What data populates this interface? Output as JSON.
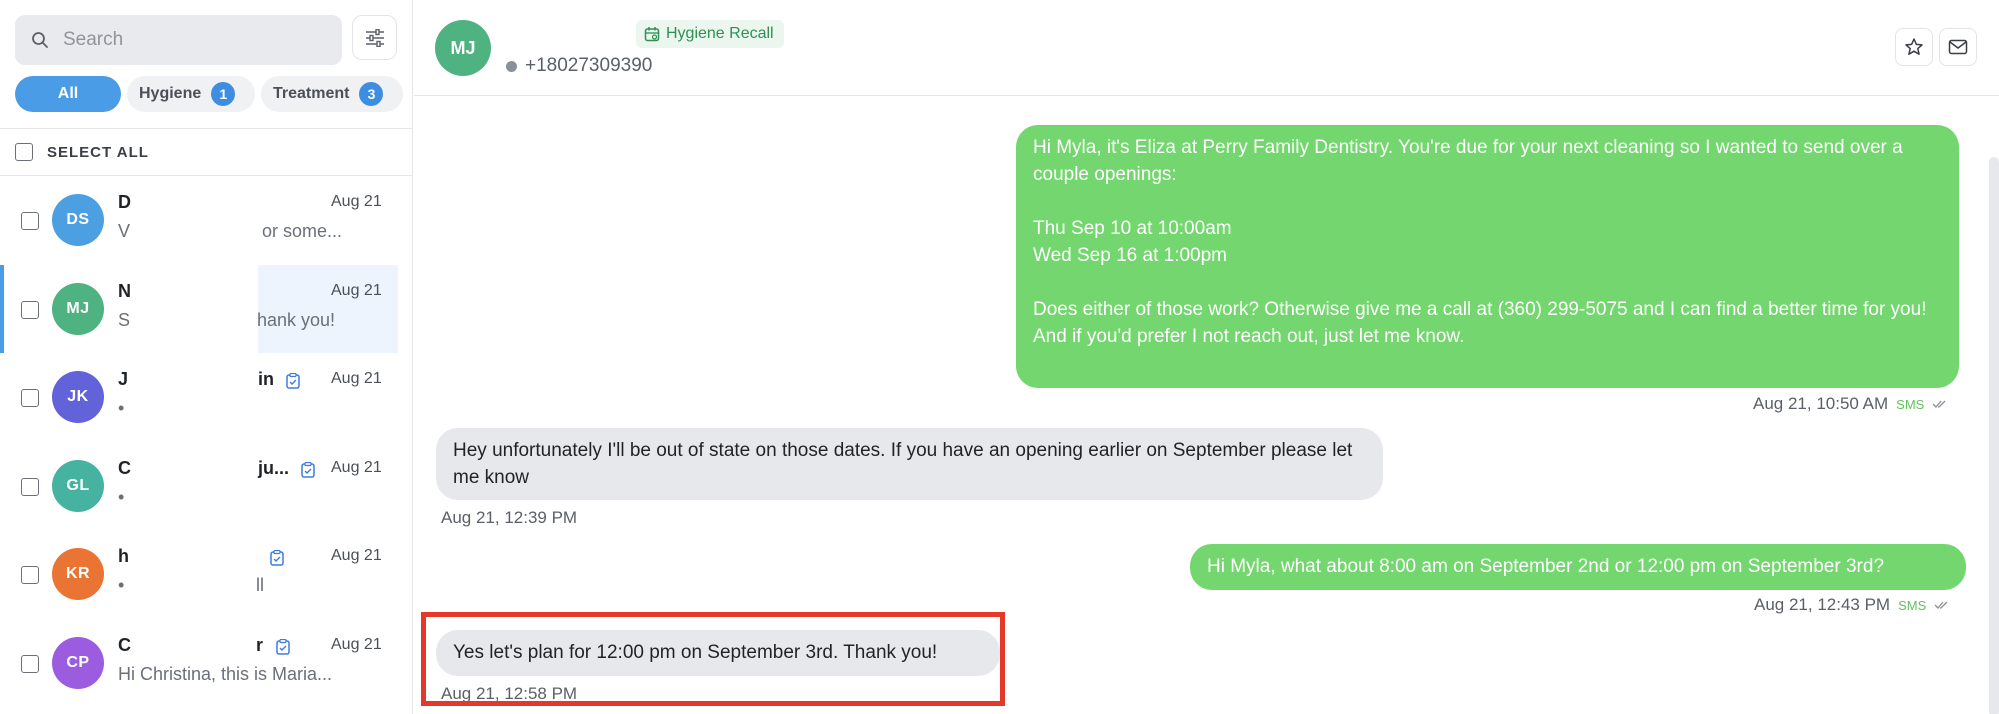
{
  "sidebar": {
    "search_placeholder": "Search",
    "filters": [
      {
        "label": "All",
        "active": true
      },
      {
        "label": "Hygiene",
        "count": "1"
      },
      {
        "label": "Treatment",
        "count": "3"
      }
    ],
    "select_all_label": "SELECT ALL",
    "conversations": [
      {
        "initials": "DS",
        "color": "#4c9fe0",
        "name": "D",
        "date": "Aug 21",
        "preview_start": "V",
        "preview_end": "or some..."
      },
      {
        "initials": "MJ",
        "color": "#4eb281",
        "name": "N",
        "date": "Aug 21",
        "preview_start": "S",
        "preview_end": "hank you!"
      },
      {
        "initials": "JK",
        "color": "#6263d9",
        "name": "J",
        "name_end": "in",
        "date": "Aug 21",
        "preview_start": "•",
        "preview_end": ""
      },
      {
        "initials": "GL",
        "color": "#45b3a0",
        "name": "C",
        "name_end": "ju...",
        "date": "Aug 21",
        "preview_start": "•",
        "preview_end": ""
      },
      {
        "initials": "KR",
        "color": "#ea7433",
        "name": "h",
        "date": "Aug 21",
        "preview_start": "•",
        "preview_end": "ll"
      },
      {
        "initials": "CP",
        "color": "#9b5cdf",
        "name": "C",
        "name_end": "r",
        "date": "Aug 21",
        "preview_start": "Hi Christina, this is Maria...",
        "preview_end": ""
      }
    ]
  },
  "header": {
    "avatar_initials": "MJ",
    "badge_label": "Hygiene Recall",
    "phone": "+18027309390"
  },
  "messages": [
    {
      "direction": "out",
      "text": "Hi Myla, it's Eliza at Perry Family Dentistry. You're due for your next cleaning so I wanted to send over a couple openings:\n\nThu Sep 10 at 10:00am\nWed Sep 16 at 1:00pm\n\nDoes either of those work? Otherwise give me a call at (360) 299-5075 and I can find a better time for you!\nAnd if you'd prefer I not reach out, just let me know.",
      "time": "Aug 21, 10:50 AM",
      "channel": "SMS"
    },
    {
      "direction": "in",
      "text": "Hey unfortunately I'll be out of state on those dates. If you have an opening earlier on September please let me know",
      "time": "Aug 21, 12:39 PM"
    },
    {
      "direction": "out",
      "text": "Hi Myla, what about 8:00 am on September 2nd or 12:00 pm on September 3rd?",
      "time": "Aug 21, 12:43 PM",
      "channel": "SMS"
    },
    {
      "direction": "in",
      "text": "Yes let's plan for 12:00 pm on September 3rd. Thank you!",
      "time": "Aug 21, 12:58 PM"
    }
  ]
}
